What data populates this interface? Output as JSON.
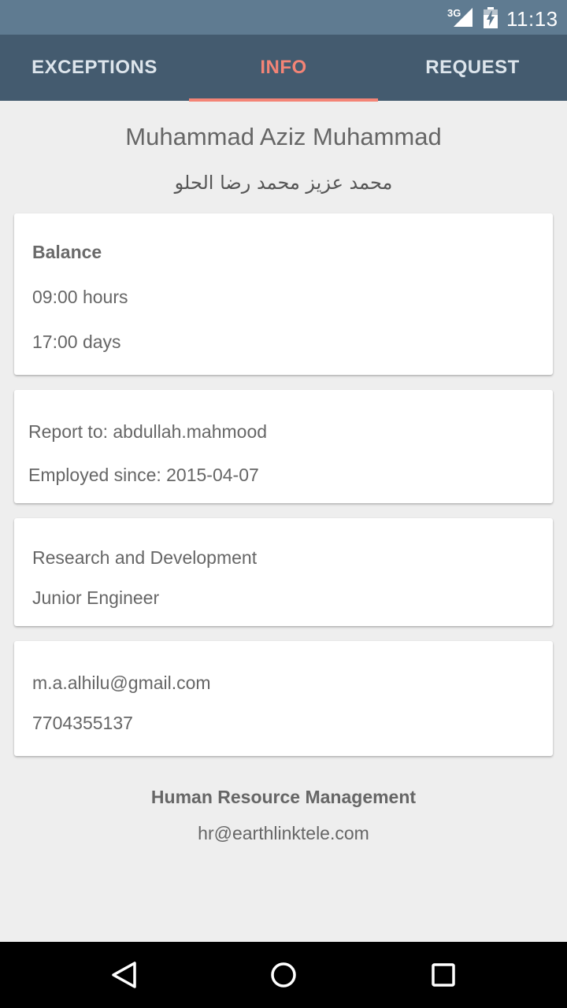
{
  "status_bar": {
    "network": "3G",
    "time": "11:13",
    "icons": [
      "signal-icon",
      "battery-charging-icon"
    ]
  },
  "tabs": [
    {
      "label": "EXCEPTIONS",
      "active": false
    },
    {
      "label": "INFO",
      "active": true
    },
    {
      "label": "REQUEST",
      "active": false
    }
  ],
  "profile": {
    "name_en": "Muhammad Aziz Muhammad",
    "name_ar": "محمد عزيز محمد رضا الحلو"
  },
  "balance": {
    "title": "Balance",
    "hours": "09:00 hours",
    "days": "17:00 days"
  },
  "report": {
    "report_to": "Report to: abdullah.mahmood",
    "employed_since": "Employed since: 2015-04-07"
  },
  "department": {
    "name": "Research and Development",
    "position": "Junior Engineer"
  },
  "contact": {
    "email": "m.a.alhilu@gmail.com",
    "phone": "7704355137"
  },
  "footer": {
    "title": "Human Resource Management",
    "email": "hr@earthlinktele.com"
  },
  "navigation": {
    "icons": [
      "back-icon",
      "home-icon",
      "recent-apps-icon"
    ]
  },
  "colors": {
    "status_bar": "#5f7b91",
    "tab_bar": "#445b6f",
    "accent": "#f48476",
    "background": "#eeeeee",
    "card": "#ffffff",
    "text": "#666666"
  }
}
